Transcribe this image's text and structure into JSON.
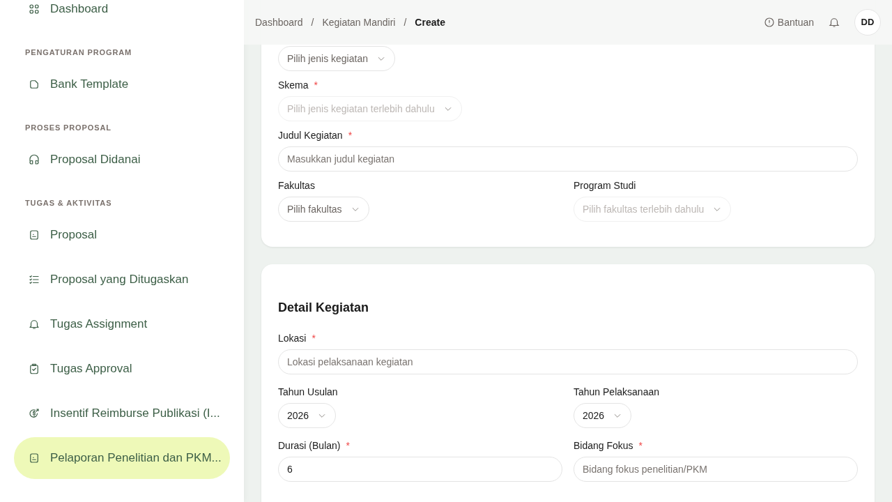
{
  "sidebar": {
    "entries": [
      {
        "kind": "link",
        "label": "Dashboard",
        "selected": false
      },
      {
        "kind": "heading",
        "label": "PENGATURAN PROGRAM"
      },
      {
        "kind": "link",
        "label": "Bank Template",
        "selected": false
      },
      {
        "kind": "heading",
        "label": "PROSES PROPOSAL"
      },
      {
        "kind": "link",
        "label": "Proposal Didanai",
        "selected": false
      },
      {
        "kind": "heading",
        "label": "TUGAS & AKTIVITAS"
      },
      {
        "kind": "link",
        "label": "Proposal",
        "selected": false
      },
      {
        "kind": "link",
        "label": "Proposal yang Ditugaskan",
        "selected": false
      },
      {
        "kind": "link",
        "label": "Tugas Assignment",
        "selected": false
      },
      {
        "kind": "link",
        "label": "Tugas Approval",
        "selected": false
      },
      {
        "kind": "link",
        "label": "Insentif Reimburse Publikasi (I...",
        "selected": false
      },
      {
        "kind": "link",
        "label": "Pelaporan Penelitian dan PKM...",
        "selected": true
      }
    ]
  },
  "header": {
    "breadcrumb": [
      {
        "label": "Dashboard",
        "current": false
      },
      {
        "label": "Kegiatan Mandiri",
        "current": false
      },
      {
        "label": "Create",
        "current": true
      }
    ],
    "separator": "/",
    "help": "Bantuan",
    "avatar": "DD"
  },
  "cards": [
    {
      "rows": [
        [
          {
            "kind": "select",
            "placeholder": "Pilih jenis kegiatan",
            "disabled": false
          }
        ],
        [
          {
            "kind": "select",
            "label": "Skema",
            "required_mark": "*",
            "placeholder": "Pilih jenis kegiatan terlebih dahulu",
            "disabled": true
          }
        ],
        [
          {
            "kind": "text",
            "label": "Judul Kegiatan",
            "required_mark": "*",
            "placeholder": "Masukkan judul kegiatan",
            "disabled": false
          }
        ],
        [
          {
            "kind": "select",
            "label": "Fakultas",
            "placeholder": "Pilih fakultas",
            "disabled": false
          },
          {
            "kind": "select",
            "label": "Program Studi",
            "placeholder": "Pilih fakultas terlebih dahulu",
            "disabled": true
          }
        ]
      ]
    },
    {
      "title": "Detail Kegiatan",
      "rows": [
        [
          {
            "kind": "text",
            "label": "Lokasi",
            "required_mark": "*",
            "placeholder": "Lokasi pelaksanaan kegiatan",
            "disabled": false
          }
        ],
        [
          {
            "kind": "select",
            "label": "Tahun Usulan",
            "value": "2026",
            "disabled": false
          },
          {
            "kind": "select",
            "label": "Tahun Pelaksanaan",
            "value": "2026",
            "disabled": false
          }
        ],
        [
          {
            "kind": "text",
            "label": "Durasi (Bulan)",
            "required_mark": "*",
            "value": "6",
            "disabled": false
          },
          {
            "kind": "text",
            "label": "Bidang Fokus",
            "required_mark": "*",
            "placeholder": "Bidang fokus penelitian/PKM",
            "disabled": false
          }
        ]
      ]
    }
  ]
}
